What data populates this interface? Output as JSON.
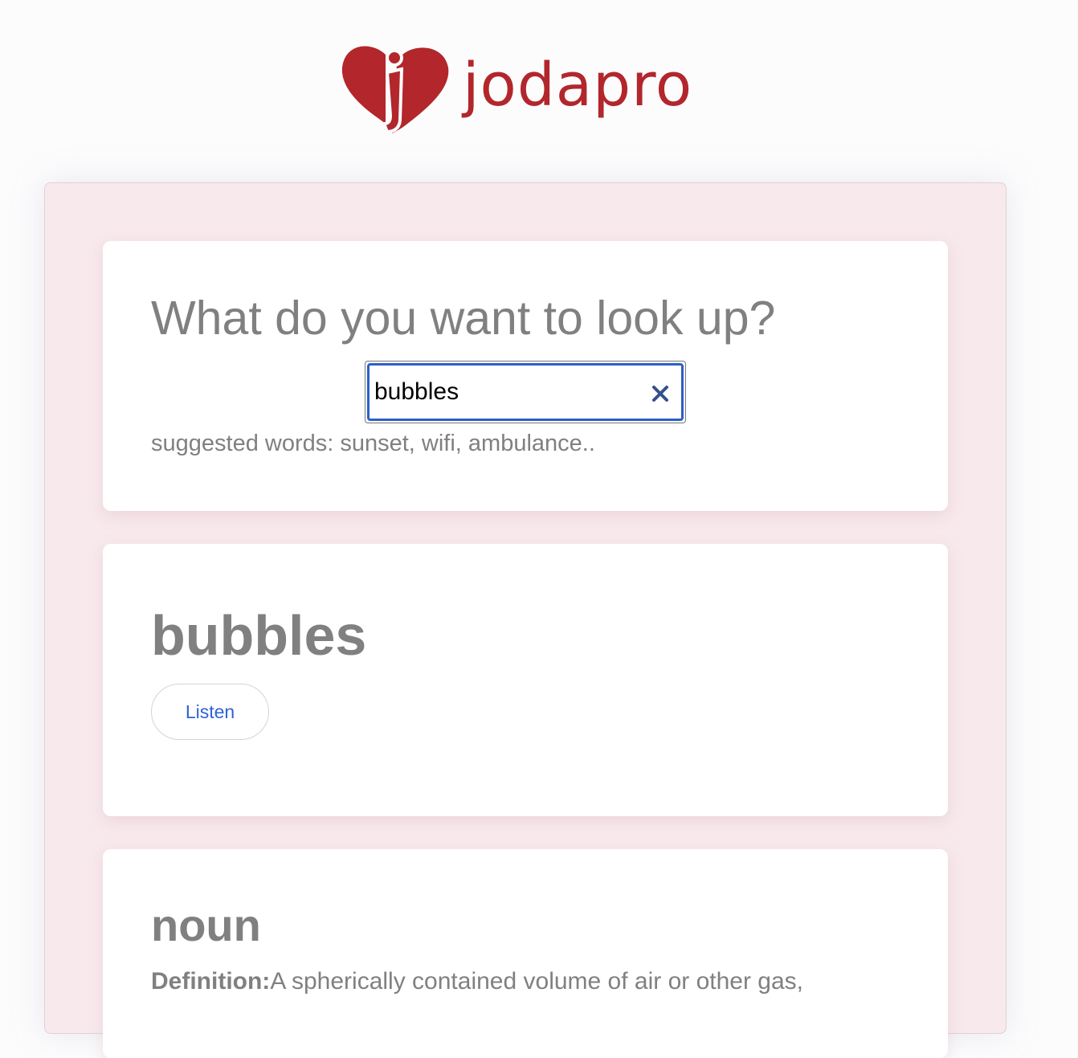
{
  "brand": {
    "name": "jodapro",
    "logo_color": "#b2262c"
  },
  "search": {
    "title": "What do you want to look up?",
    "input_value": "bubbles",
    "clear_icon": "close-icon",
    "suggested": "suggested words: sunset, wifi, ambulance.."
  },
  "word": {
    "title": "bubbles",
    "listen_label": "Listen"
  },
  "meaning": {
    "part_of_speech": "noun",
    "definition_label": "Definition:",
    "definition_text": "A spherically contained volume of air or other gas,"
  },
  "colors": {
    "accent": "#2d5fc4",
    "link": "#2f63d6",
    "panel_bg": "#f8e9ec",
    "text_gray": "#808080"
  }
}
